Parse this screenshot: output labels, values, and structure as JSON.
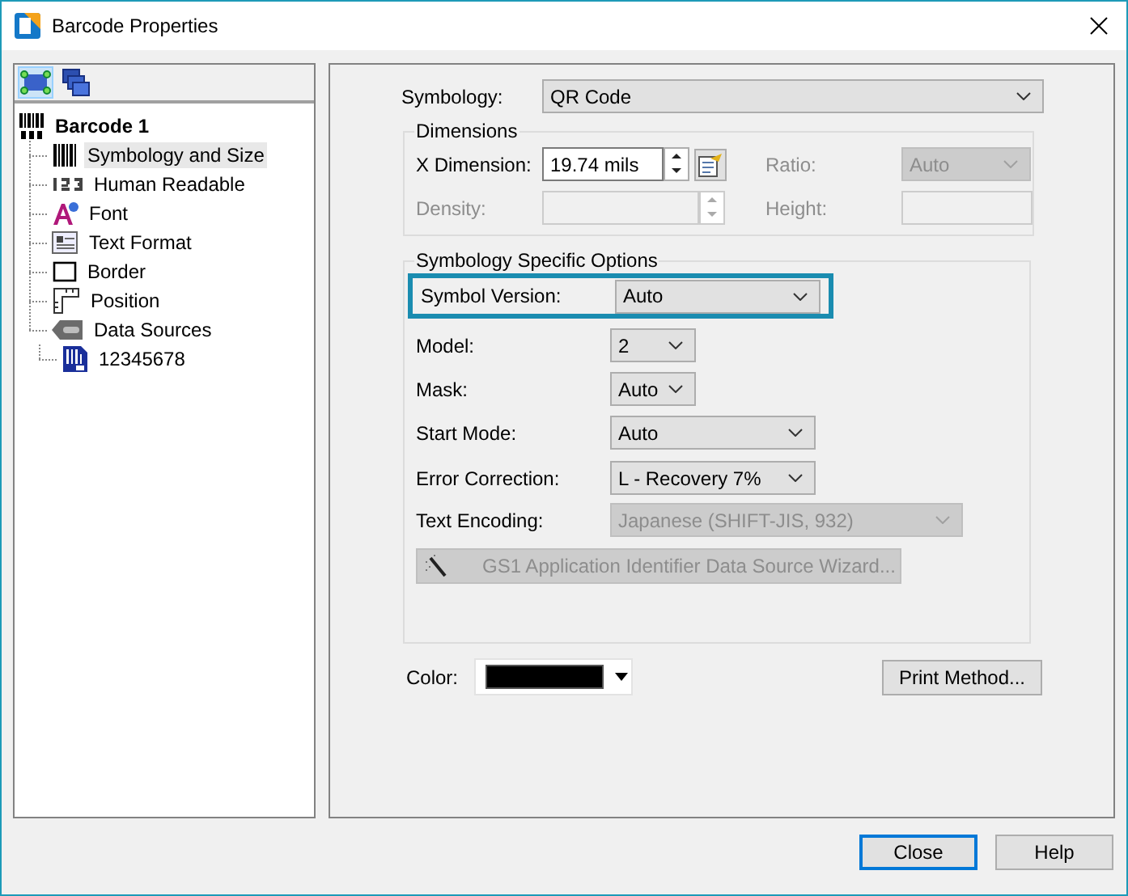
{
  "window": {
    "title": "Barcode Properties"
  },
  "toolbar": [
    {
      "kind": "layout",
      "selected": true
    },
    {
      "kind": "layers",
      "selected": false
    }
  ],
  "tree": {
    "label": "Barcode 1",
    "kind": "barcode",
    "selected": false,
    "children": [
      {
        "label": "Symbology and Size",
        "kind": "bars",
        "selected": true
      },
      {
        "label": "Human Readable",
        "kind": "digits",
        "selected": false
      },
      {
        "label": "Font",
        "kind": "font",
        "selected": false
      },
      {
        "label": "Text Format",
        "kind": "textformat",
        "selected": false
      },
      {
        "label": "Border",
        "kind": "border",
        "selected": false
      },
      {
        "label": "Position",
        "kind": "position",
        "selected": false
      },
      {
        "label": "Data Sources",
        "kind": "datasource",
        "selected": false,
        "children": [
          {
            "label": "12345678",
            "kind": "barcodedoc",
            "selected": false
          }
        ]
      }
    ]
  },
  "symbology": {
    "label": "Symbology:",
    "value": "QR Code"
  },
  "dimensions": {
    "title": "Dimensions",
    "x_dimension": {
      "label": "X Dimension:",
      "value": "19.74 mils",
      "disabled": false
    },
    "density": {
      "label": "Density:",
      "disabled": true
    },
    "ratio": {
      "label": "Ratio:",
      "value": "Auto",
      "disabled": true
    },
    "height": {
      "label": "Height:",
      "disabled": true
    }
  },
  "options": {
    "title": "Symbology Specific Options",
    "rows": [
      {
        "label": "Symbol Version:",
        "value": "Auto",
        "highlighted": true,
        "disabled": false
      },
      {
        "label": "Model:",
        "value": "2",
        "highlighted": false,
        "disabled": false
      },
      {
        "label": "Mask:",
        "value": "Auto",
        "highlighted": false,
        "disabled": false
      },
      {
        "label": "Start Mode:",
        "value": "Auto",
        "highlighted": false,
        "disabled": false
      },
      {
        "label": "Error Correction:",
        "value": "L - Recovery 7%",
        "highlighted": false,
        "disabled": false
      },
      {
        "label": "Text Encoding:",
        "value": "Japanese (SHIFT-JIS, 932)",
        "highlighted": false,
        "disabled": true
      }
    ],
    "wizard_button": {
      "label": "GS1 Application Identifier Data Source Wizard...",
      "disabled": true
    }
  },
  "color": {
    "label": "Color:",
    "color": "#000000"
  },
  "print_method_button": "Print Method...",
  "buttons": [
    {
      "label": "Close",
      "default": true
    },
    {
      "label": "Help",
      "default": false
    }
  ]
}
